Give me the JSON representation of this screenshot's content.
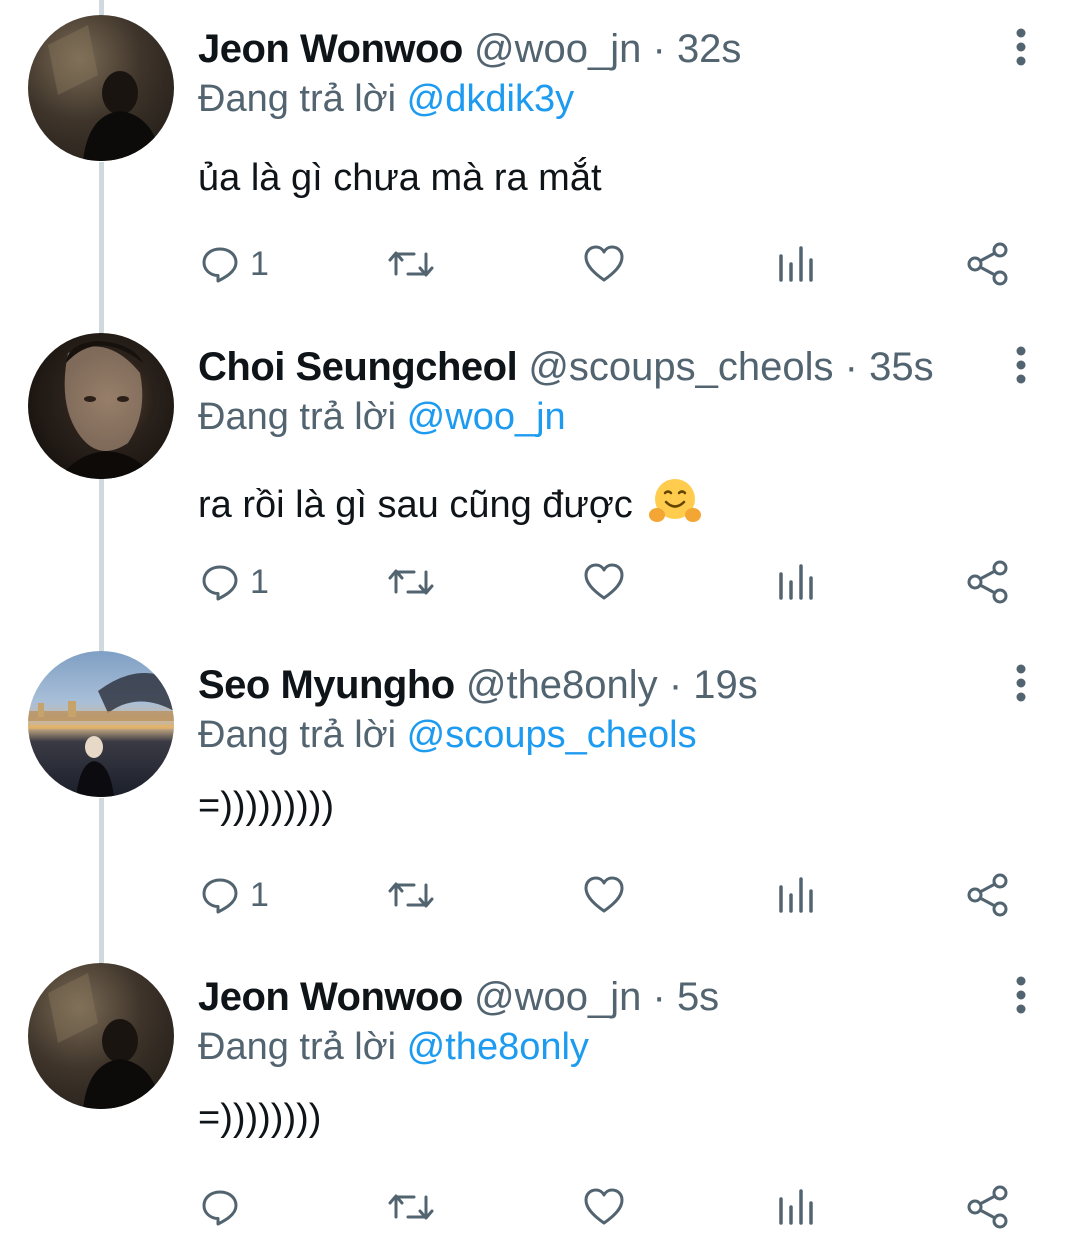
{
  "tweets": [
    {
      "name": "Jeon Wonwoo",
      "handle": "@woo_jn",
      "time": "32s",
      "reply_prefix": "Đang trả lời",
      "reply_to": "@dkdik3y",
      "text": "ủa là gì chưa mà ra mắt",
      "reply_count": "1",
      "avatar": "dark-portrait"
    },
    {
      "name": "Choi Seungcheol",
      "handle": "@scoups_cheols",
      "time": "35s",
      "reply_prefix": "Đang trả lời",
      "reply_to": "@woo_jn",
      "text": "ra rồi là gì sau cũng được",
      "emoji": "hugging-face-emoji",
      "reply_count": "1",
      "avatar": "night-portrait"
    },
    {
      "name": "Seo Myungho",
      "handle": "@the8only",
      "time": "19s",
      "reply_prefix": "Đang trả lời",
      "reply_to": "@scoups_cheols",
      "text": "=)))))))))",
      "reply_count": "1",
      "avatar": "city-river"
    },
    {
      "name": "Jeon Wonwoo",
      "handle": "@woo_jn",
      "time": "5s",
      "reply_prefix": "Đang trả lời",
      "reply_to": "@the8only",
      "text": "=))))))))",
      "reply_count": "",
      "avatar": "dark-portrait"
    }
  ],
  "separator": "·",
  "icons": [
    "reply-icon",
    "retweet-icon",
    "like-icon",
    "analytics-icon",
    "share-icon",
    "more-icon"
  ],
  "colors": {
    "text": "#0f1419",
    "secondary": "#536471",
    "link": "#1d9bf0",
    "thread_line": "#cfd9de"
  }
}
